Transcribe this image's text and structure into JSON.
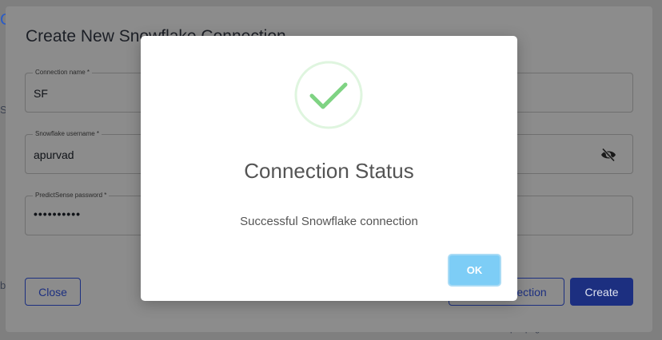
{
  "background": {
    "fragment_c": "C",
    "fragment_s": "S",
    "fragment_b": "b",
    "items_per_page": "Items per page"
  },
  "connection_modal": {
    "title": "Create New Snowflake Connection",
    "fields": [
      {
        "label": "Connection name *",
        "value": "SF"
      },
      {
        "label": "Snowflake username *",
        "value": "apurvad"
      },
      {
        "label": "PredictSense password *",
        "value": "••••••••••"
      }
    ],
    "close_label": "Close",
    "test_label": "Test Connection",
    "create_label": "Create"
  },
  "status_dialog": {
    "title": "Connection Status",
    "message": "Successful Snowflake connection",
    "ok_label": "OK",
    "icon": "success-check-icon"
  },
  "colors": {
    "primary": "#1c2f80",
    "ok_button": "#7dcdf6",
    "success_ring": "#dff5df",
    "success_check": "#7fd383"
  }
}
